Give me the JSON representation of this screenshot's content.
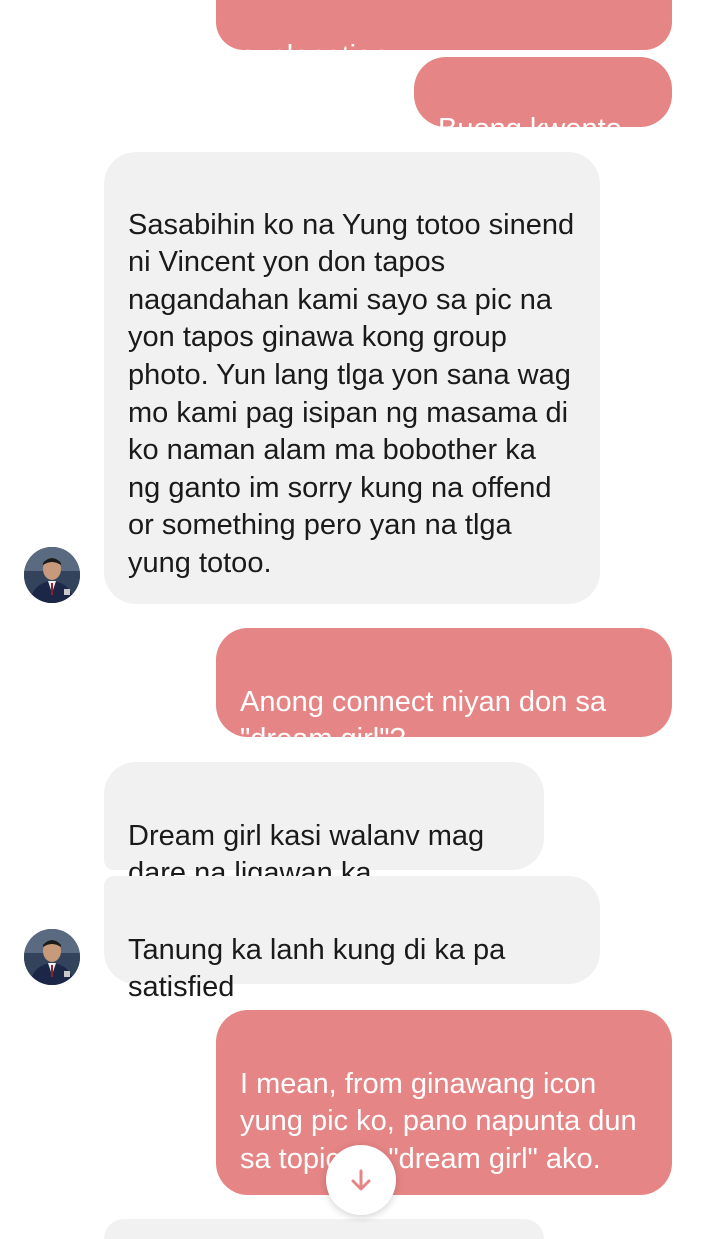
{
  "conversation": {
    "messages": [
      {
        "sender": "me",
        "text": "explanation."
      },
      {
        "sender": "me",
        "text": "Buong kwento."
      },
      {
        "sender": "other",
        "text": "Sasabihin ko na Yung totoo sinend ni Vincent yon don tapos nagandahan kami sayo sa pic na yon tapos ginawa kong group photo. Yun lang tlga yon sana wag mo kami pag isipan ng masama di ko naman alam ma bobother ka ng ganto im sorry kung na offend or something pero yan na tlga yung totoo."
      },
      {
        "sender": "me",
        "text": "Anong connect niyan don sa \"dream girl\"?"
      },
      {
        "sender": "other",
        "text": "Dream girl kasi walanv mag dare na ligawan ka"
      },
      {
        "sender": "other",
        "text": "Tanung ka lanh kung di ka pa satisfied"
      },
      {
        "sender": "me",
        "text": "I mean, from ginawang icon yung pic ko, pano napunta dun sa topic na \"dream girl\" ako."
      }
    ]
  },
  "colors": {
    "outgoing_bubble": "#e68585",
    "incoming_bubble": "#f1f1f1",
    "scroll_arrow": "#e68585"
  },
  "icons": {
    "scroll_down": "arrow-down-icon"
  }
}
